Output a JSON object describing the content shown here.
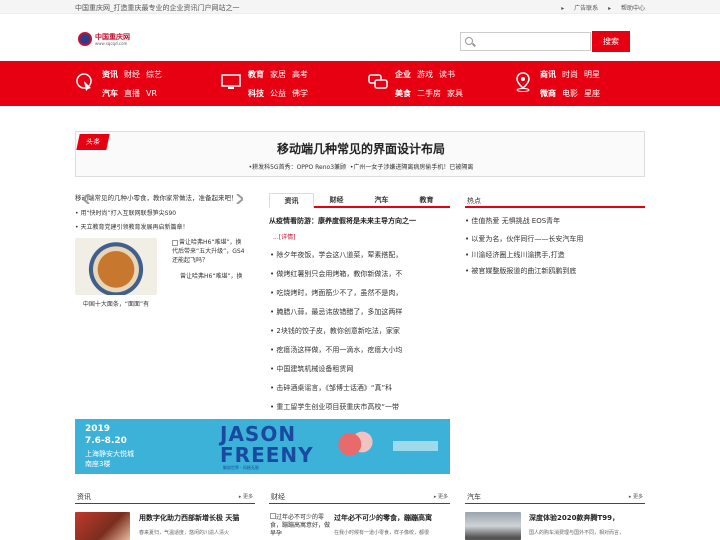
{
  "topbar": {
    "site": "中国重庆网_打造重庆最专业的企业资讯门户网站之一",
    "ad_contact": "广告联系",
    "help": "帮助中心"
  },
  "logo": {
    "name": "中国重庆网",
    "url": "www.sqcqd.com"
  },
  "search": {
    "placeholder": "",
    "button": "搜索"
  },
  "nav": {
    "g1": {
      "r1": [
        "资讯",
        "财经",
        "综艺"
      ],
      "r2": [
        "汽车",
        "直播",
        "VR"
      ]
    },
    "g2": {
      "r1": [
        "教育",
        "家居",
        "高考"
      ],
      "r2": [
        "科技",
        "公益",
        "佛学"
      ]
    },
    "g3": {
      "r1": [
        "企业",
        "游戏",
        "读书"
      ],
      "r2": [
        "美食",
        "二手房",
        "家具"
      ]
    },
    "g4": {
      "r1": [
        "商讯",
        "时尚",
        "明星"
      ],
      "r2": [
        "微商",
        "电影",
        "星座"
      ]
    }
  },
  "banner": {
    "tag": "头条",
    "title": "移动端几种常见的界面设计布局",
    "sub1": "•耕发科5G首秀：OPPO Reno3兼顾",
    "sub2": "•广州一女子涉嫌进隔离病房偷手机！已被隔离"
  },
  "slide": {
    "caption": "移动端常见的几种小零食，教你家常做法，准备起来吧！",
    "lines": [
      "用“快时尚”打入互联网联想笋尖S90",
      "天立教育党建引领教育发展再启新篇章！"
    ]
  },
  "dish": {
    "caption": "中国十大面条，“面面”有"
  },
  "broken": {
    "l1": "曾让哈弗H6“难堪”，换",
    "l2": "代后带来“五大升级”，GS4",
    "l3": "还能起飞吗？",
    "l4": "曾让哈弗H6“难堪”，换"
  },
  "tabs": [
    "资讯",
    "财经",
    "汽车",
    "教育"
  ],
  "news": {
    "headline": "从疫情看防游：康养度假将是未来主导方向之一",
    "more": "...[详情]",
    "items": [
      "除夕年夜饭，学会这八道菜，荤素搭配，",
      "做烤红薯别只会用烤箱，教你新做法，不",
      "吃烧烤时，烤面筋少不了，虽然不是肉，",
      "腌腊八蒜，最忌讳放错醋了，多加这两样",
      "2块钱的饺子皮，教你创意新吃法，家家",
      "疙瘩汤这样做，不用一滴水，疙瘩大小均",
      "中国建筑机械设备租赁网",
      "击碎酒桌谣言，《邹博士话酒》“真”科",
      "重工留学生创业项目获重庆市高校“一带"
    ]
  },
  "hot": {
    "title": "热点",
    "items": [
      "佳值热爱 无惧挑战 EOS青年",
      "以爱为名，伙伴同行——长安汽车用",
      "川渝经济圈上线川渝携手,打造",
      "被官媒整版报道的曲江新鸥鹏到底"
    ]
  },
  "ad": {
    "year": "2019",
    "dates": "7.6-8.20",
    "place1": "上海静安大悦城",
    "place2": "南座3楼",
    "j1": "JASON",
    "j2": "FREENY",
    "jsub": "解剖世界 · 风格无限"
  },
  "sections": [
    {
      "title": "资讯",
      "more": "更多",
      "head": "用数字化助力西部新增长极 天猫",
      "sub": "春来夏归，气温适度，悠闲的川渝人清火"
    },
    {
      "title": "财经",
      "more": "更多",
      "head": "过年必不可少的零食，蹦蹦高寓",
      "sub": "在我小时候有一道小零食，样子像绞，都很",
      "alt": "过年必不可少的零食，蹦蹦高寓意好，做早孕"
    },
    {
      "title": "汽车",
      "more": "更多",
      "head": "深度体验2020款奔腾T99，",
      "sub": "国人的购车消费理与国外不同，相对而言，"
    }
  ],
  "colors": {
    "brand": "#e60012",
    "ad_bg": "#3cb2d9"
  }
}
